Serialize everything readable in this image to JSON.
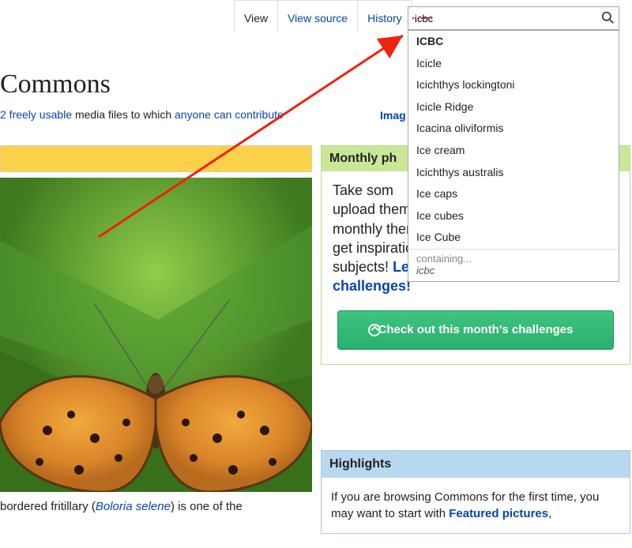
{
  "tabs": {
    "view": "View",
    "source": "View source",
    "history": "History"
  },
  "search": {
    "value": "icbc",
    "suggestions": [
      "ICBC",
      "Icicle",
      "Icichthys lockingtoni",
      "Icicle Ridge",
      "Icacina oliviformis",
      "Ice cream",
      "Icichthys australis",
      "Ice caps",
      "Ice cubes",
      "Ice Cube"
    ],
    "containing_label": "containing...",
    "containing_term": "icbc"
  },
  "page_title": "Commons",
  "tagline": {
    "count_fragment": "2 freely usable",
    "mid": " media files to which ",
    "link": "anyone can contribute"
  },
  "imag_text": "Imag",
  "monthly": {
    "header": "Monthly ph",
    "body_pre": "Take som",
    "body_line2": "upload them to meet our monthly thematic challenge, get inspiration and try new subjects!",
    "learn": "Learn more about the challenges!",
    "cta": "Check out this month's challenges"
  },
  "highlights": {
    "header": "Highlights",
    "body_pre": "If you are browsing Commons for the first time, you may want to start with ",
    "featured": "Featured pictures",
    "comma": ","
  },
  "caption": {
    "pre": "bordered fritillary (",
    "species": "Boloria selene",
    "post": ") is one of the"
  }
}
